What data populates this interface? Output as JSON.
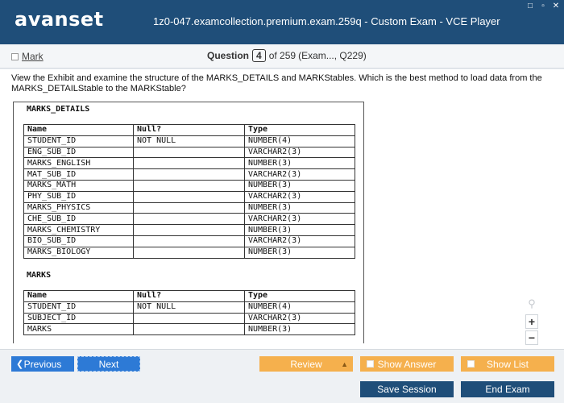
{
  "app": {
    "logo": "avanset",
    "title": "1z0-047.examcollection.premium.exam.259q - Custom Exam - VCE Player",
    "window_controls": [
      "square-icon",
      "minimize-icon",
      "close-icon"
    ]
  },
  "header": {
    "mark_label": "Mark",
    "question_label": "Question",
    "question_number": "4",
    "of_total": "of 259",
    "exam_ref": "(Exam..., Q229)"
  },
  "question": {
    "text": "View the Exhibit and examine the structure of the MARKS_DETAILS and MARKStables. Which is the best method to load data from the MARKS_DETAILStable to the MARKStable?"
  },
  "exhibit": {
    "tables": [
      {
        "title": "MARKS_DETAILS",
        "columns": [
          "Name",
          "Null?",
          "Type"
        ],
        "rows": [
          [
            "STUDENT_ID",
            "NOT NULL",
            "NUMBER(4)"
          ],
          [
            "ENG_SUB_ID",
            "",
            "VARCHAR2(3)"
          ],
          [
            "MARKS_ENGLISH",
            "",
            "NUMBER(3)"
          ],
          [
            "MAT_SUB_ID",
            "",
            "VARCHAR2(3)"
          ],
          [
            "MARKS_MATH",
            "",
            "NUMBER(3)"
          ],
          [
            "PHY_SUB_ID",
            "",
            "VARCHAR2(3)"
          ],
          [
            "MARKS_PHYSICS",
            "",
            "NUMBER(3)"
          ],
          [
            "CHE_SUB_ID",
            "",
            "VARCHAR2(3)"
          ],
          [
            "MARKS_CHEMISTRY",
            "",
            "NUMBER(3)"
          ],
          [
            "BIO_SUB_ID",
            "",
            "VARCHAR2(3)"
          ],
          [
            "MARKS_BIOLOGY",
            "",
            "NUMBER(3)"
          ]
        ]
      },
      {
        "title": "MARKS",
        "columns": [
          "Name",
          "Null?",
          "Type"
        ],
        "rows": [
          [
            "STUDENT_ID",
            "NOT NULL",
            "NUMBER(4)"
          ],
          [
            "SUBJECT_ID",
            "",
            "VARCHAR2(3)"
          ],
          [
            "MARKS",
            "",
            "NUMBER(3)"
          ]
        ]
      }
    ]
  },
  "zoom": {
    "in": "+",
    "out": "−"
  },
  "nav": {
    "previous": "Previous",
    "next": "Next",
    "review": "Review",
    "show_answer": "Show Answer",
    "show_list": "Show List"
  },
  "footer": {
    "save_session": "Save Session",
    "end_exam": "End Exam"
  },
  "colors": {
    "titlebar": "#1f4e79",
    "nav_blue": "#2d7ad6",
    "orange": "#f5b04d"
  }
}
